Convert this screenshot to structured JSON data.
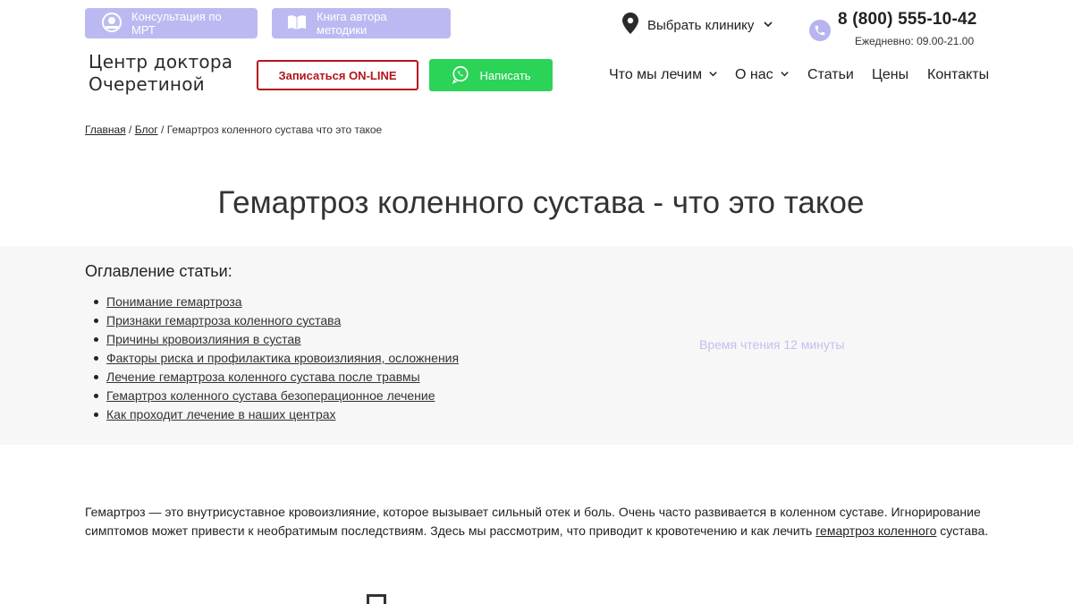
{
  "top_bar": {
    "mrt_label": "Консультация по МРТ",
    "book_label": "Книга автора методики",
    "clinic_select": "Выбрать клинику",
    "phone": "8 (800) 555-10-42",
    "hours": "Ежедневно: 09.00-21.00"
  },
  "logo": {
    "line1": "Центр доктора",
    "line2": "Очеретиной"
  },
  "actions": {
    "online_label": "Записаться ON-LINE",
    "whatsapp_label": "Написать"
  },
  "nav": {
    "treat": "Что мы лечим",
    "about": "О нас",
    "articles": "Статьи",
    "prices": "Цены",
    "contacts": "Контакты"
  },
  "breadcrumb": {
    "home": "Главная",
    "blog": "Блог",
    "current": "Гемартроз коленного сустава что это такое",
    "separator": "/"
  },
  "title": "Гемартроз коленного сустава - что это такое",
  "toc": {
    "heading": "Оглавление статьи:",
    "items": [
      "Понимание гемартроза",
      "Признаки гемартроза коленного сустава",
      "Причины кровоизлияния в сустав",
      "Факторы риска и профилактика кровоизлияния, осложнения",
      "Лечение гемартроза коленного сустава после травмы",
      "Гемартроз коленного сустава безоперационное лечение ",
      "Как проходит лечение в наших центрах"
    ],
    "read_time": "Время чтения 12 минуты"
  },
  "intro": {
    "text": "Гемартроз  — это внутрисуставное кровоизлияние, которое вызывает сильный отек и боль. Очень часто развивается в коленном суставе. Игнорирование симптомов может привести к необратимым последствиям. Здесь мы рассмотрим, что приводит к кровотечению и как лечить ",
    "link": "гемартроз коленного",
    "tail": " сустава."
  },
  "colors": {
    "pill_bg": "#bcb9f2",
    "online_red": "#b3151b",
    "whatsapp_green": "#2bd357",
    "toc_band": "#f7f7f7",
    "read_time": "#c2c0ee"
  }
}
